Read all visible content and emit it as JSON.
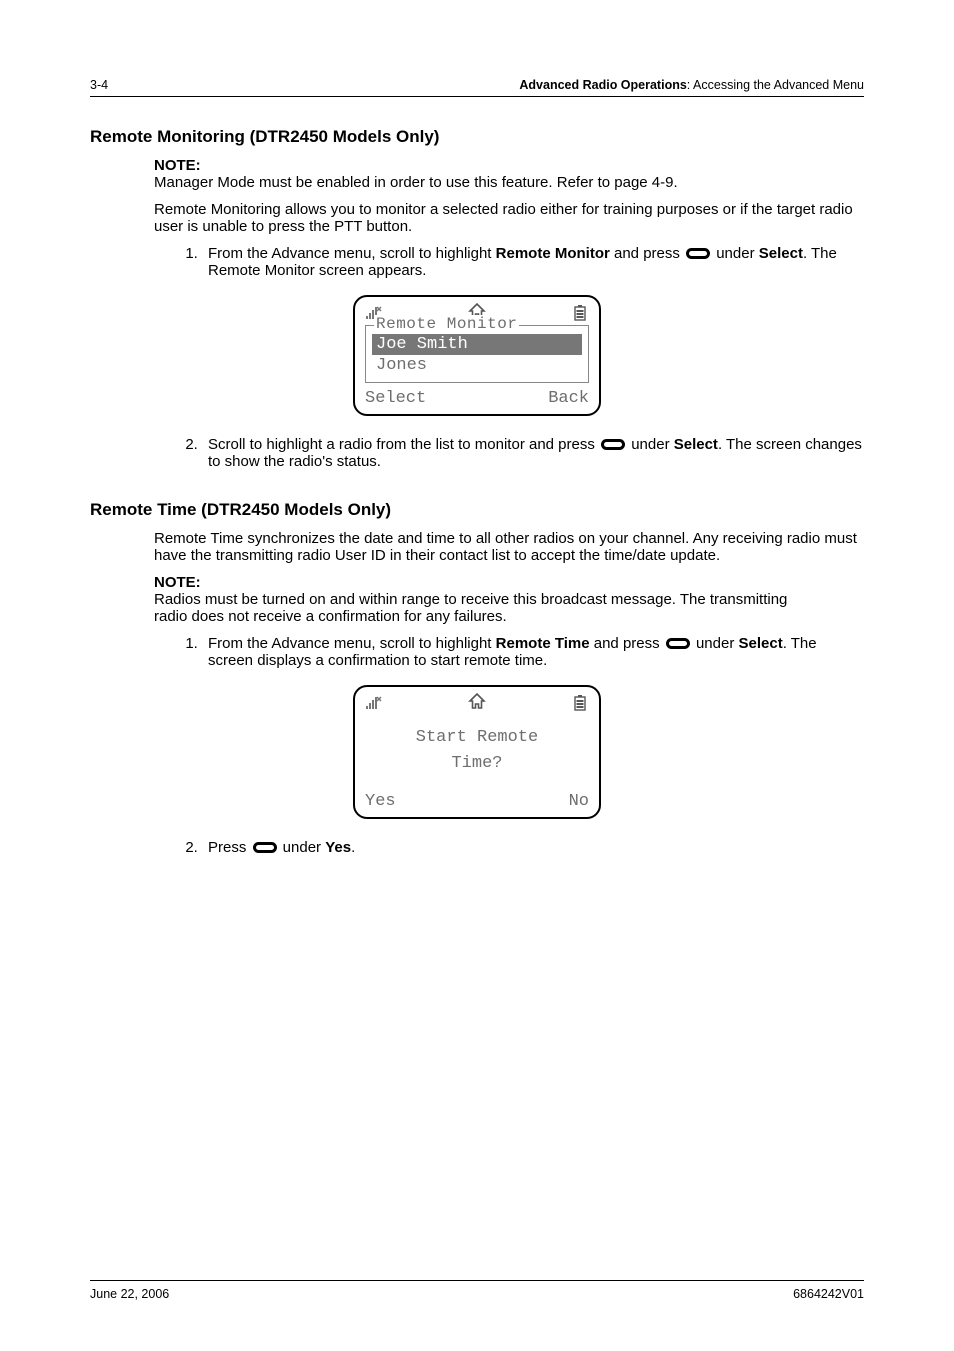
{
  "header": {
    "page_num": "3-4",
    "title_bold": "Advanced Radio Operations",
    "title_rest": ": Accessing the Advanced Menu"
  },
  "section1": {
    "heading": "Remote Monitoring (DTR2450 Models Only)",
    "note_label": "NOTE:",
    "note_text": "Manager Mode must be enabled in order to use this feature. Refer to page 4-9.",
    "para": "Remote Monitoring allows you to monitor a selected radio either for training purposes or if the target radio user is unable to press the PTT button.",
    "step1_a": "From the Advance menu, scroll to highlight ",
    "step1_b": "Remote Monitor",
    "step1_c": " and press ",
    "step1_d": " under ",
    "step1_e": "Select",
    "step1_f": ". The Remote Monitor screen appears.",
    "step2_a": "Scroll to highlight a radio from the list to monitor and press ",
    "step2_b": " under ",
    "step2_c": "Select",
    "step2_d": ". The screen changes to show the radio's status."
  },
  "lcd1": {
    "legend": "Remote Monitor",
    "items": [
      "Joe Smith",
      "Jones"
    ],
    "selected_index": 0,
    "left_soft": "Select",
    "right_soft": "Back"
  },
  "section2": {
    "heading": "Remote Time (DTR2450 Models Only)",
    "para": "Remote Time synchronizes the date and time to all other radios on your channel. Any receiving radio must have the transmitting radio User ID in their contact list to accept the time/date update.",
    "note_label": "NOTE:",
    "note_text": "Radios must be turned on and within range to receive this broadcast message. The transmitting radio does not receive a confirmation for any failures.",
    "step1_a": "From the Advance menu, scroll to highlight ",
    "step1_b": "Remote Time",
    "step1_c": " and press ",
    "step1_d": " under ",
    "step1_e": "Select",
    "step1_f": ". The screen displays a confirmation to start remote time.",
    "step2_a": "Press ",
    "step2_b": " under ",
    "step2_c": "Yes",
    "step2_d": "."
  },
  "lcd2": {
    "line1": "Start Remote",
    "line2": "Time?",
    "left_soft": "Yes",
    "right_soft": "No"
  },
  "footer": {
    "date": "June 22, 2006",
    "doc_id": "6864242V01"
  }
}
